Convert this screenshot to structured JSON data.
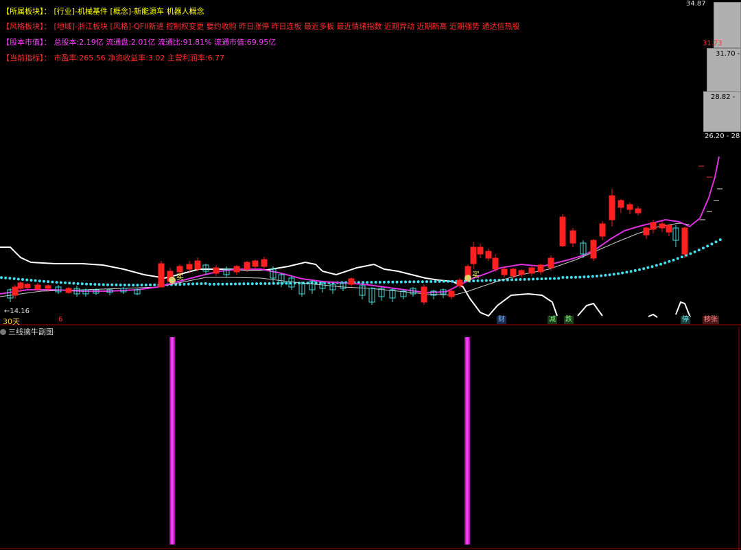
{
  "info": {
    "sector": {
      "key": "【所属板块】：",
      "value": "[行业]-机械基件 [概念]-新能源车 机器人概念",
      "key_color": "#ffff00",
      "value_color": "#ffff00"
    },
    "style": {
      "key": "【风格板块】：",
      "value": "[地域]-浙江板块 [风格]-QFII新进 控制权变更 要约收购 昨日涨停 昨日连板 最近多板 最近情绪指数 近期异动 近期新高 近期强势 通达信热股",
      "key_color": "#ff3030",
      "value_color": "#ff3030"
    },
    "capital": {
      "key": "【股本市值】：",
      "value": "总股本:2.19亿 流通盘:2.01亿 流通比:91.81% 流通市值:69.95亿",
      "key_color": "#ff40ff",
      "value_color": "#ff40ff"
    },
    "indicators": {
      "key": "【当前指标】：",
      "value": "市盈率:265.56 净资收益率:3.02 主营利润率:6.77",
      "key_color": "#ff3030",
      "value_color": "#ff3030"
    }
  },
  "axis": {
    "high": "34.87",
    "p1": "31.73",
    "p2": "31.70 -",
    "p3": "28.82 -",
    "p4": "26.20 - 28",
    "low_marker": "←14.16",
    "period": "30天",
    "tick_small": "6"
  },
  "markers": {
    "buy1": "买",
    "buy2": "买"
  },
  "tags": [
    {
      "label": "财",
      "color": "#80c0ff",
      "bg": "#1a2a4a"
    },
    {
      "label": "减",
      "color": "#80ff80",
      "bg": "#1a3a1a"
    },
    {
      "label": "跌",
      "color": "#80ff80",
      "bg": "#1a3a1a"
    },
    {
      "label": "停",
      "color": "#80ffff",
      "bg": "#1a3a3a"
    },
    {
      "label": "移张",
      "color": "#ff8080",
      "bg": "#4a1a1a"
    }
  ],
  "subpanel": {
    "title": "三线擒牛副图"
  },
  "colors": {
    "up": "#ff2020",
    "down": "#40e0e0",
    "ma": "#e030e0",
    "band": "#ffffff",
    "dots": "#40e0f0",
    "signal": "#ff30ff"
  }
}
